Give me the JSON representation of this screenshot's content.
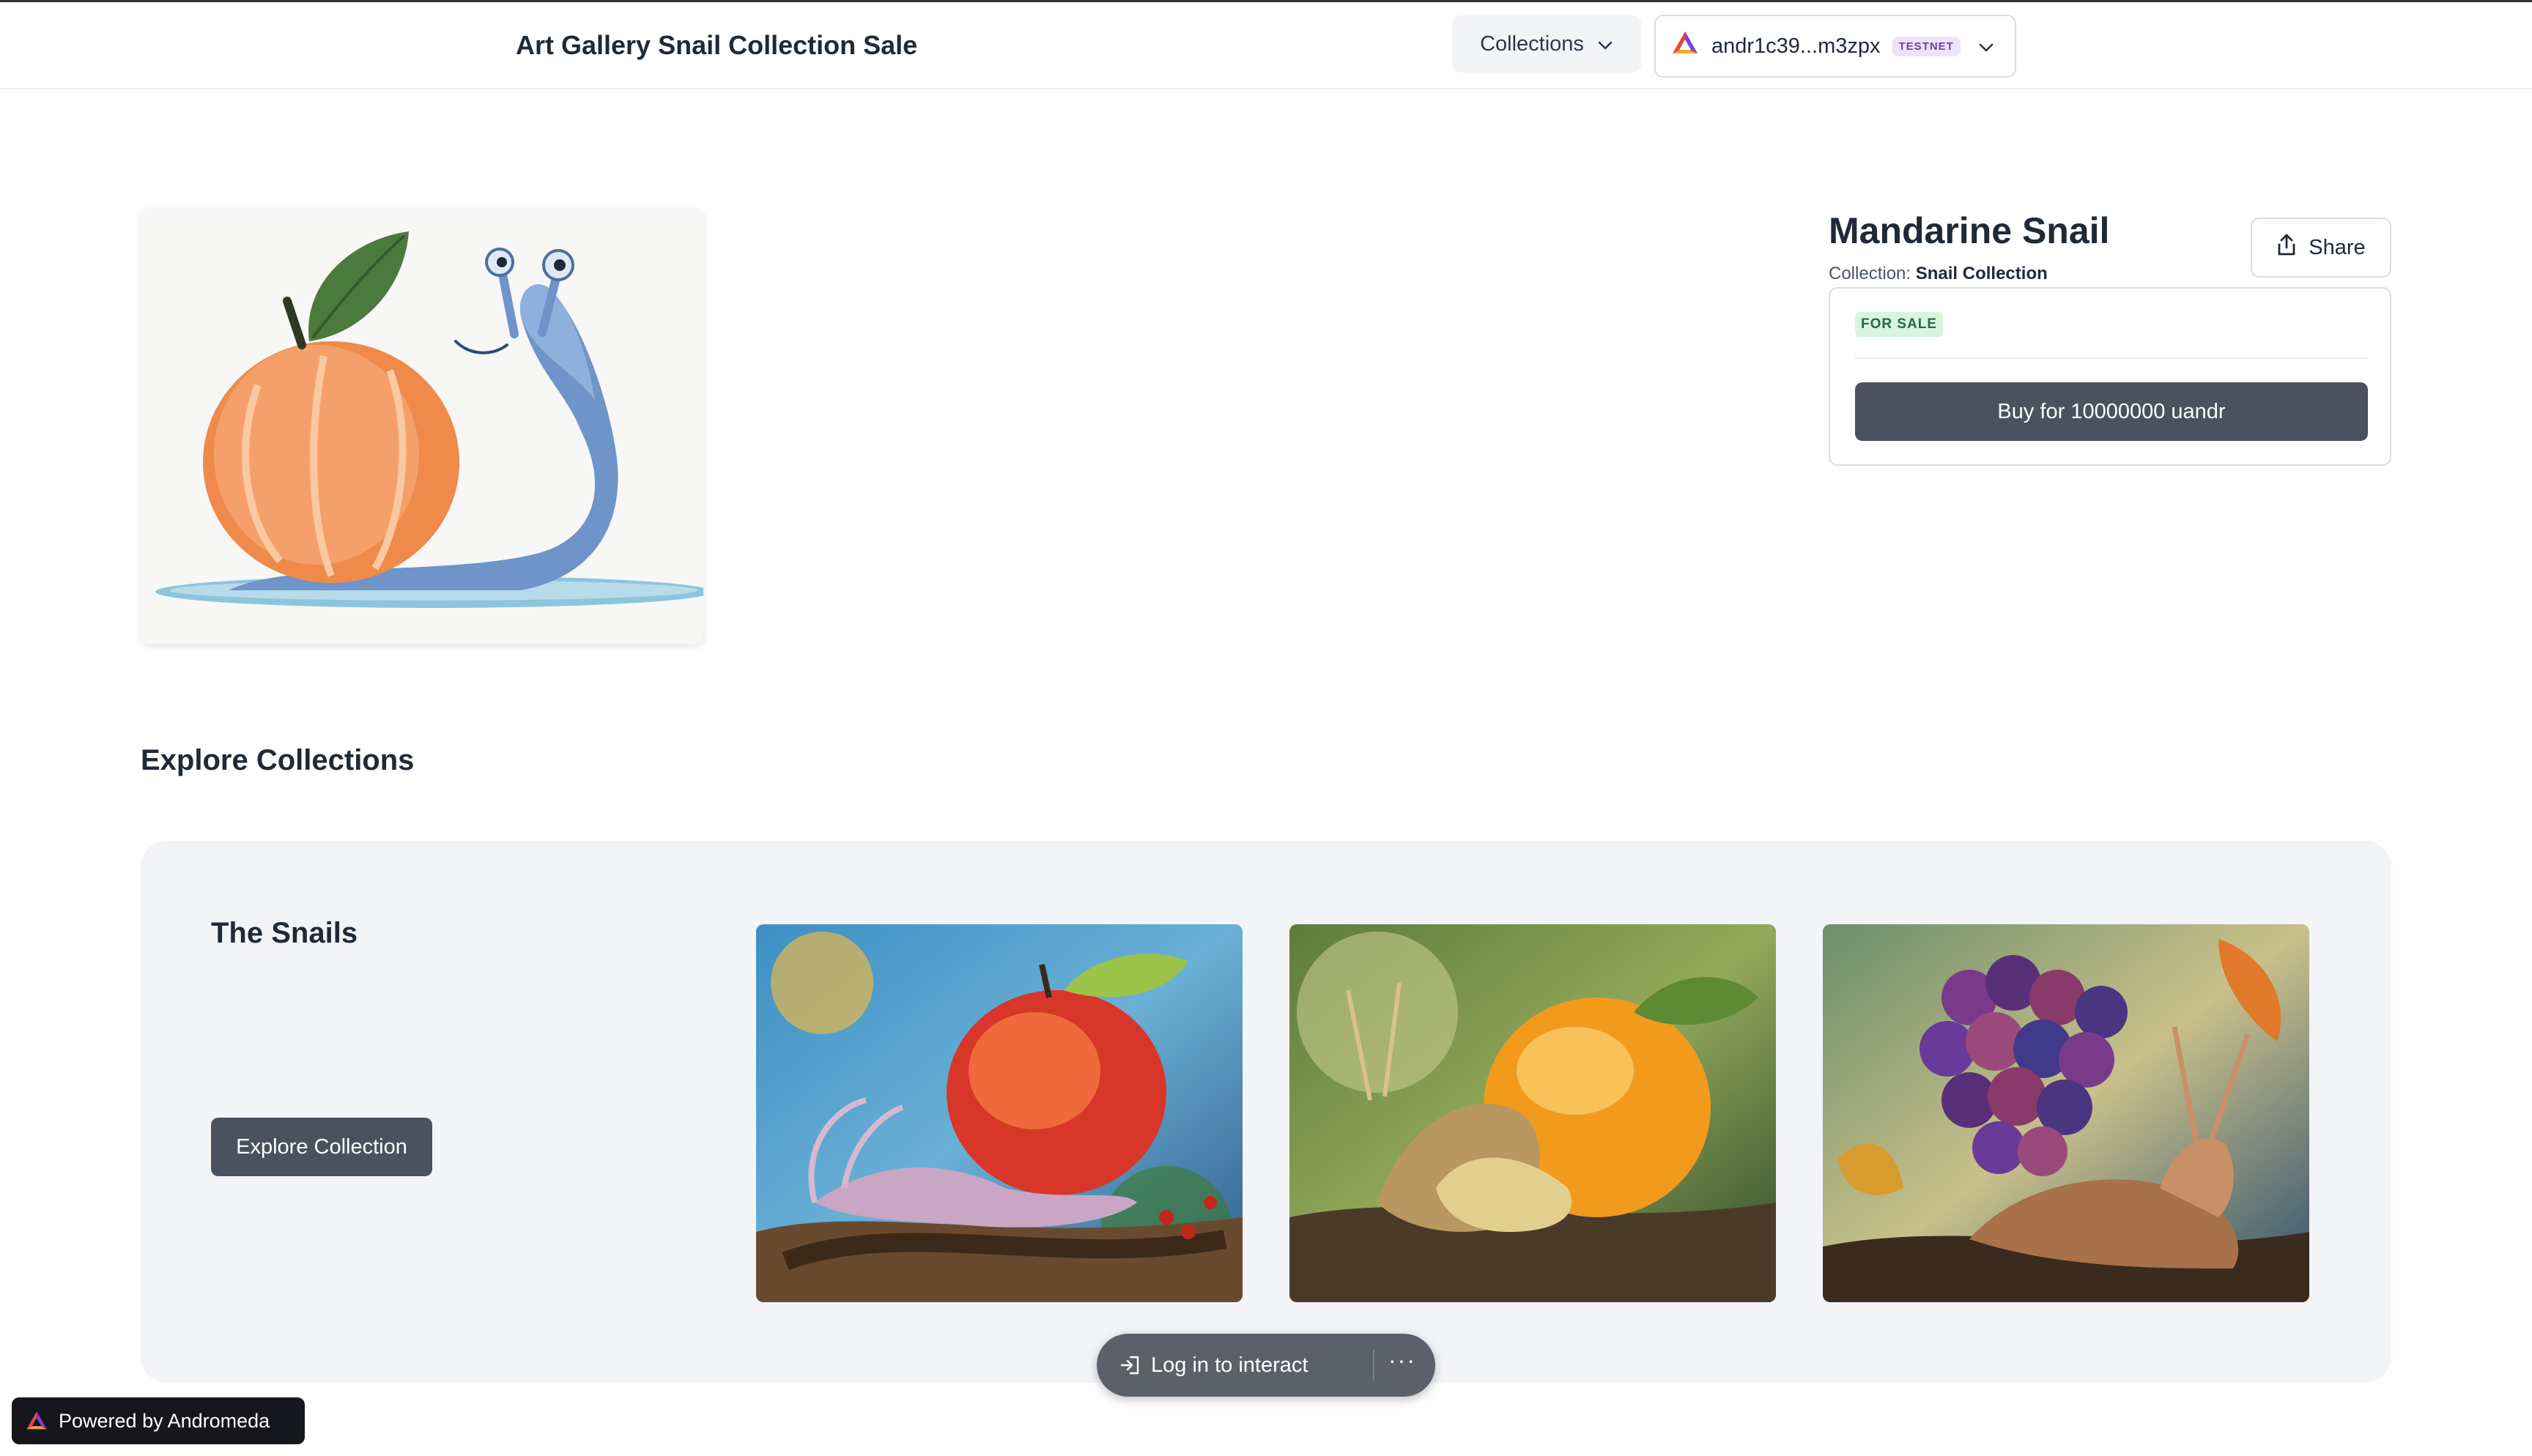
{
  "header": {
    "site_title": "Art Gallery Snail Collection Sale",
    "collections_label": "Collections",
    "wallet_address": "andr1c39...m3zpx",
    "network_badge": "TESTNET"
  },
  "nft": {
    "title": "Mandarine Snail",
    "collection_prefix": "Collection:",
    "collection_name": "Snail Collection",
    "share_label": "Share",
    "status_badge": "FOR SALE",
    "buy_label": "Buy for 10000000 uandr"
  },
  "explore": {
    "heading": "Explore Collections",
    "collection": {
      "name": "The Snails",
      "button_label": "Explore Collection",
      "thumbnails": [
        "snail-apple-painting",
        "snail-orange-painting",
        "snail-grapes-painting"
      ]
    }
  },
  "floating_bar": {
    "login_label": "Log in to interact",
    "more_label": "···"
  },
  "footer": {
    "powered_label": "Powered by Andromeda"
  },
  "colors": {
    "primary_button": "#4a5260",
    "panel_bg": "#f3f4f7",
    "sale_badge_bg": "#d7f5df",
    "testnet_badge_bg": "#ede4fb"
  }
}
